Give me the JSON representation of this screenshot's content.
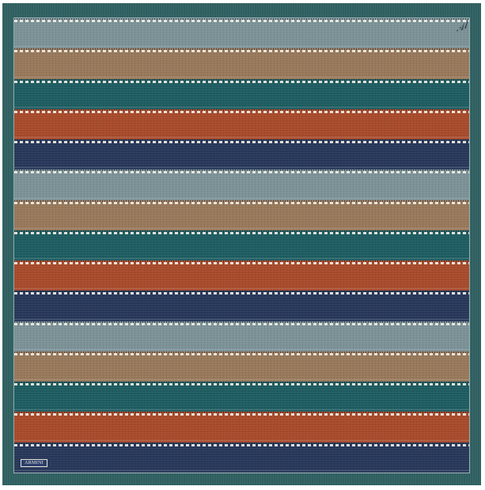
{
  "brand_tag": "ARMINI",
  "stripe_colors": [
    "#7b9297",
    "#98785a",
    "#1d5c61",
    "#a84a2b",
    "#27375a"
  ],
  "stripe_cycle_count": 3,
  "border_color": "#2f5f60",
  "stitch_color": "#f3f0e8"
}
